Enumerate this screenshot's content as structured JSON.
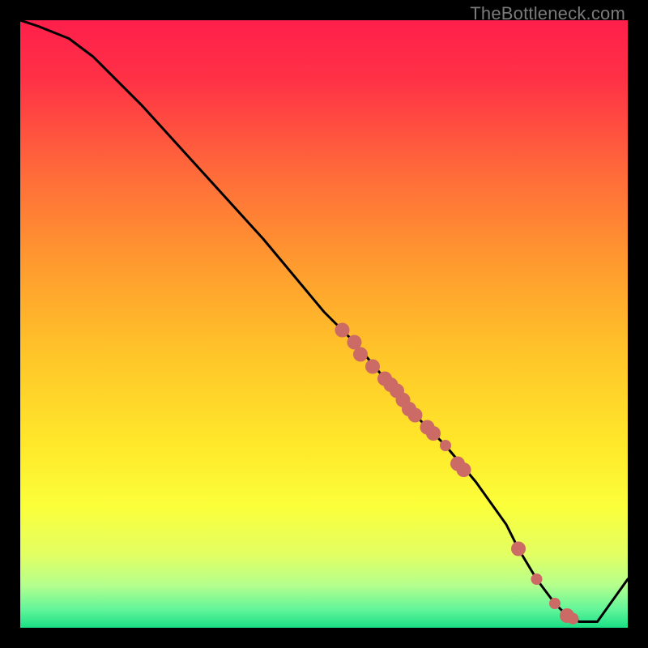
{
  "watermark": "TheBottleneck.com",
  "chart_data": {
    "type": "line",
    "title": "",
    "xlabel": "",
    "ylabel": "",
    "xlim": [
      0,
      100
    ],
    "ylim": [
      0,
      100
    ],
    "grid": false,
    "legend": false,
    "series": [
      {
        "name": "curve",
        "color": "#000000",
        "x": [
          0,
          3,
          8,
          12,
          20,
          30,
          40,
          50,
          55,
          60,
          65,
          70,
          75,
          80,
          82,
          85,
          88,
          90,
          92,
          95,
          100
        ],
        "y": [
          100,
          99,
          97,
          94,
          86,
          75,
          64,
          52,
          47,
          41,
          35,
          30,
          24,
          17,
          13,
          8,
          4,
          2,
          1,
          1,
          8
        ]
      }
    ],
    "points": {
      "color": "#cc6a66",
      "radius_big": 9,
      "radius_small": 7,
      "data": [
        {
          "x": 53,
          "y": 49,
          "r": "big"
        },
        {
          "x": 55,
          "y": 47,
          "r": "big"
        },
        {
          "x": 56,
          "y": 45,
          "r": "big"
        },
        {
          "x": 58,
          "y": 43,
          "r": "big"
        },
        {
          "x": 60,
          "y": 41,
          "r": "big"
        },
        {
          "x": 61,
          "y": 40,
          "r": "big"
        },
        {
          "x": 62,
          "y": 39,
          "r": "big"
        },
        {
          "x": 63,
          "y": 37.5,
          "r": "big"
        },
        {
          "x": 64,
          "y": 36,
          "r": "big"
        },
        {
          "x": 65,
          "y": 35,
          "r": "big"
        },
        {
          "x": 67,
          "y": 33,
          "r": "big"
        },
        {
          "x": 68,
          "y": 32,
          "r": "big"
        },
        {
          "x": 70,
          "y": 30,
          "r": "small"
        },
        {
          "x": 72,
          "y": 27,
          "r": "big"
        },
        {
          "x": 73,
          "y": 26,
          "r": "big"
        },
        {
          "x": 82,
          "y": 13,
          "r": "big"
        },
        {
          "x": 85,
          "y": 8,
          "r": "small"
        },
        {
          "x": 88,
          "y": 4,
          "r": "small"
        },
        {
          "x": 90,
          "y": 2,
          "r": "big"
        },
        {
          "x": 91,
          "y": 1.5,
          "r": "small"
        }
      ]
    },
    "gradient_stops": [
      {
        "offset": 0.0,
        "color": "#ff1f4b"
      },
      {
        "offset": 0.1,
        "color": "#ff3246"
      },
      {
        "offset": 0.25,
        "color": "#ff6a3a"
      },
      {
        "offset": 0.4,
        "color": "#ff9a2f"
      },
      {
        "offset": 0.55,
        "color": "#ffc529"
      },
      {
        "offset": 0.7,
        "color": "#ffe82a"
      },
      {
        "offset": 0.8,
        "color": "#fbff3a"
      },
      {
        "offset": 0.88,
        "color": "#e2ff63"
      },
      {
        "offset": 0.93,
        "color": "#b4ff8d"
      },
      {
        "offset": 0.97,
        "color": "#62f59a"
      },
      {
        "offset": 1.0,
        "color": "#1adf85"
      }
    ]
  }
}
